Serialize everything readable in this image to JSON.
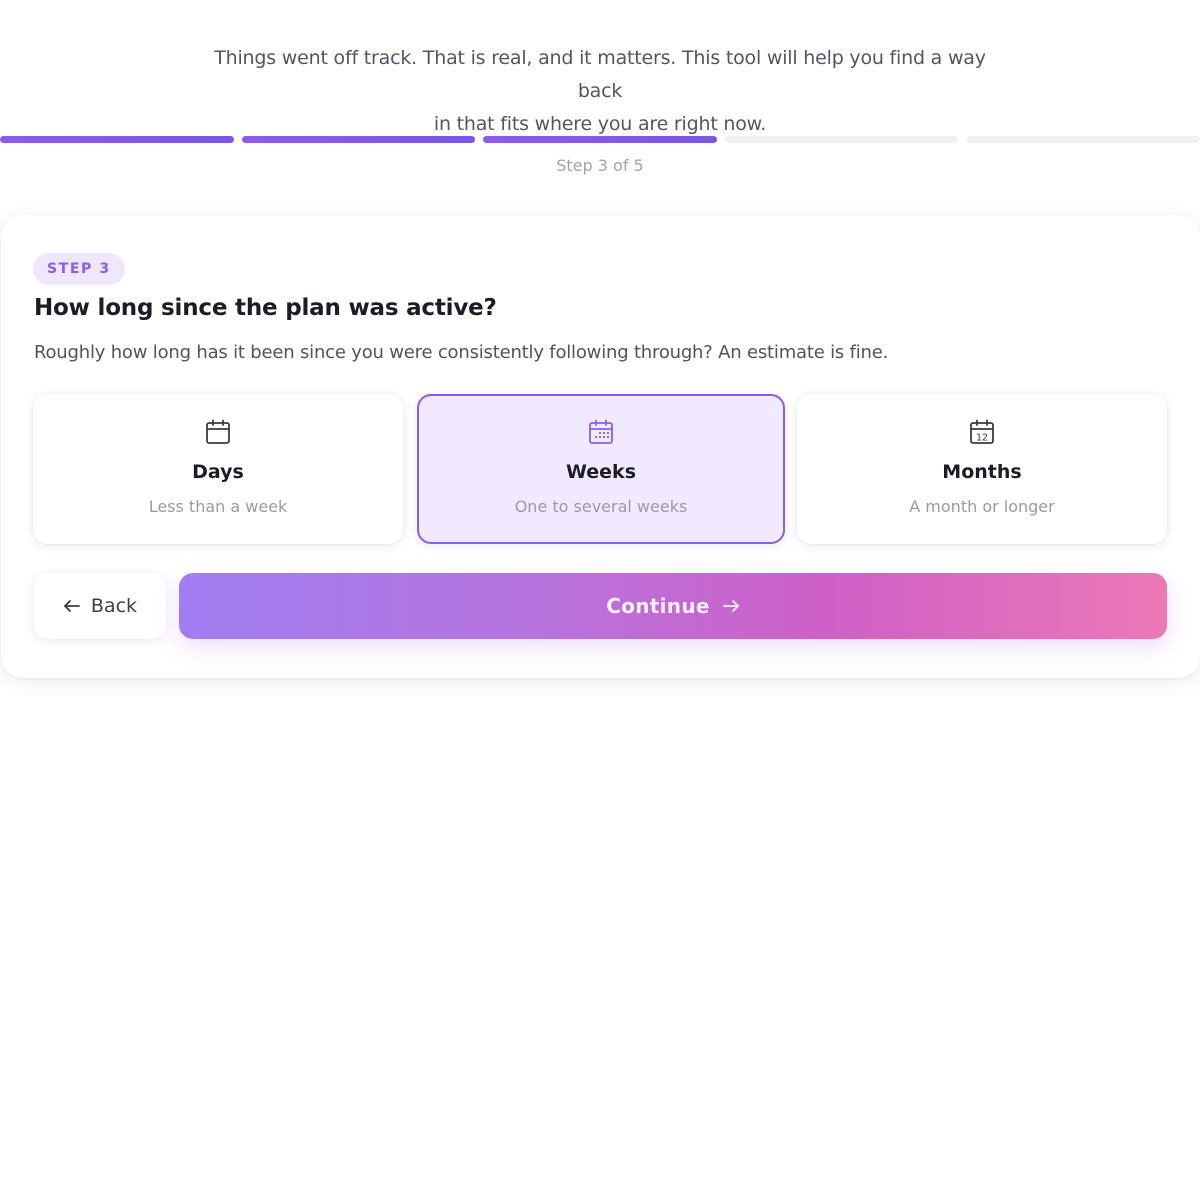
{
  "intro": {
    "line1": "Things went off track. That is real, and it matters. This tool will help you find a way back",
    "line2": "in that fits where you are right now."
  },
  "progress": {
    "total_steps": 5,
    "completed_steps": 3,
    "label": "Step 3 of 5",
    "active_color": "#7b55ea",
    "inactive_color": "#f1f1f4"
  },
  "card": {
    "badge": "STEP 3",
    "question": "How long since the plan was active?",
    "subtitle": "Roughly how long has it been since you were consistently following through? An estimate is fine.",
    "options": [
      {
        "title": "Days",
        "description": "Less than a week",
        "icon": "calendar-icon",
        "selected": false
      },
      {
        "title": "Weeks",
        "description": "One to several weeks",
        "icon": "calendar-dots-icon",
        "selected": true
      },
      {
        "title": "Months",
        "description": "A month or longer",
        "icon": "calendar-12-icon",
        "icon_text": "12",
        "selected": false
      }
    ],
    "back_label": "Back",
    "continue_label": "Continue",
    "accent_color": "#8a5cf0"
  }
}
